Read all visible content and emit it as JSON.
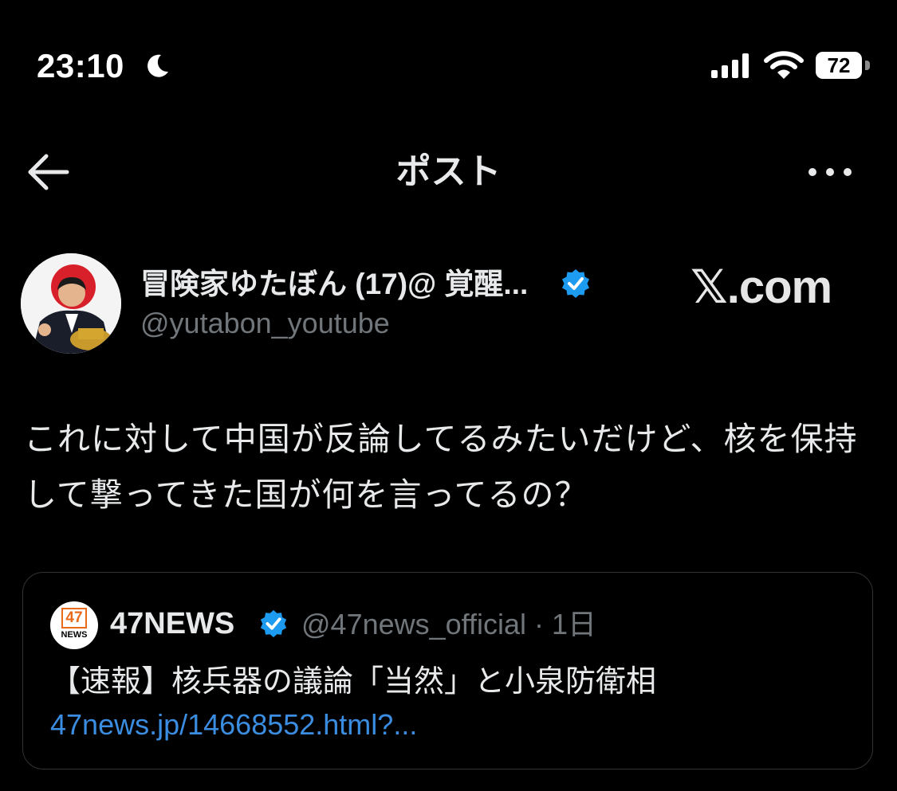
{
  "status_bar": {
    "time": "23:10",
    "battery": "72",
    "icons": [
      "moon-icon",
      "signal-icon",
      "wifi-icon",
      "battery-icon"
    ]
  },
  "header": {
    "title": "ポスト",
    "back_icon": "arrow-left-icon",
    "more_icon": "more-horizontal-icon"
  },
  "post": {
    "author_name": "冒険家ゆたぼん (17)@ 覚醒...",
    "author_handle": "@yutabon_youtube",
    "verified": true,
    "watermark": "𝕏.com",
    "text": "これに対して中国が反論してるみたいだけど、核を保持して撃ってきた国が何を言ってるの？"
  },
  "quote": {
    "logo_number": "47",
    "logo_text": "NEWS",
    "name": "47NEWS",
    "verified": true,
    "handle_time": "@47news_official · 1日",
    "text": "【速報】核兵器の議論「当然」と小泉防衛相",
    "link": "47news.jp/14668552.html?..."
  },
  "colors": {
    "background": "#000000",
    "text": "#e7e9ea",
    "secondary": "#71767b",
    "verified": "#1d9bf0",
    "link": "#3a8de0",
    "border": "#2f3336"
  }
}
